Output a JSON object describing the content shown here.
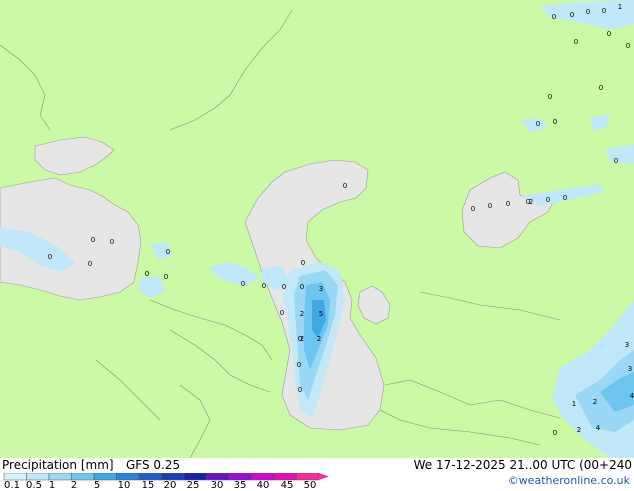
{
  "legend": {
    "title": "Precipitation [mm]",
    "model": "GFS 0.25",
    "ticks": [
      "0.1",
      "0.5",
      "1",
      "2",
      "5",
      "10",
      "15",
      "20",
      "25",
      "30",
      "35",
      "40",
      "45",
      "50"
    ],
    "colors": [
      "#d8f0fa",
      "#c0e8f8",
      "#9ad8f5",
      "#6cc6f0",
      "#3fa9e6",
      "#2b84d9",
      "#2060c8",
      "#1c3fb8",
      "#1a22a8",
      "#6a14c0",
      "#9b0fd0",
      "#c80ccc",
      "#e010b8",
      "#f030a0"
    ]
  },
  "datetime": "We 17-12-2025 21..00 UTC (00+240",
  "credit": "©weatheronline.co.uk",
  "map": {
    "land_color": "#ccf9a6",
    "sea_color": "#e6e6e6",
    "labels": [
      {
        "t": "0"
      },
      {
        "t": "0"
      },
      {
        "t": "0"
      },
      {
        "t": "0"
      },
      {
        "t": "1"
      },
      {
        "t": "0"
      },
      {
        "t": "0"
      },
      {
        "t": "0"
      },
      {
        "t": "0"
      },
      {
        "t": "0"
      },
      {
        "t": "0"
      },
      {
        "t": "0"
      },
      {
        "t": "0"
      },
      {
        "t": "0"
      },
      {
        "t": "0"
      },
      {
        "t": "0"
      },
      {
        "t": "0"
      },
      {
        "t": "0"
      },
      {
        "t": "0"
      },
      {
        "t": "2"
      },
      {
        "t": "0"
      },
      {
        "t": "0"
      },
      {
        "t": "0"
      },
      {
        "t": "0"
      },
      {
        "t": "0"
      },
      {
        "t": "0"
      },
      {
        "t": "0"
      },
      {
        "t": "0"
      },
      {
        "t": "0"
      },
      {
        "t": "0"
      },
      {
        "t": "0"
      },
      {
        "t": "0"
      },
      {
        "t": "0"
      },
      {
        "t": "2"
      },
      {
        "t": "3"
      },
      {
        "t": "0"
      },
      {
        "t": "5"
      },
      {
        "t": "0"
      },
      {
        "t": "2"
      },
      {
        "t": "2"
      },
      {
        "t": "0"
      },
      {
        "t": "0"
      },
      {
        "t": "3"
      },
      {
        "t": "3"
      },
      {
        "t": "2"
      },
      {
        "t": "4"
      },
      {
        "t": "1"
      },
      {
        "t": "2"
      },
      {
        "t": "0"
      },
      {
        "t": "4"
      }
    ]
  }
}
